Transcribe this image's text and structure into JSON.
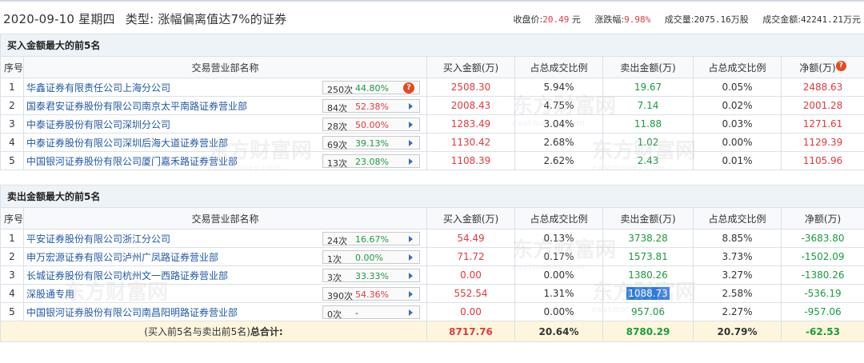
{
  "header": {
    "date": "2020-09-10",
    "weekday": "星期四",
    "type_label": "类型:",
    "type_value": "涨幅偏离值达7%的证券",
    "close_label": "收盘价:",
    "close_value": "20.49",
    "close_unit": "元",
    "change_label": "涨跌幅:",
    "change_value": "9.98%",
    "volume_label": "成交量:",
    "volume_value": "2075.16万股",
    "amount_label": "成交金额:",
    "amount_value": "42241.21万元"
  },
  "columns": {
    "idx": "序号",
    "name": "交易营业部名称",
    "buy": "买入金额(万)",
    "buy_ratio": "占总成交比例",
    "sell": "卖出金额(万)",
    "sell_ratio": "占总成交比例",
    "net": "净额(万)",
    "net_badge": "?"
  },
  "buy_section": {
    "title": "买入金额最大的前5名",
    "rows": [
      {
        "idx": "1",
        "name": "华鑫证券有限责任公司上海分公司",
        "count": "250次",
        "pct": "44.80%",
        "pct_color": "green",
        "badge": "?",
        "buy": "2508.30",
        "buy_ratio": "5.94%",
        "sell": "19.67",
        "sell_ratio": "0.05%",
        "net": "2488.63"
      },
      {
        "idx": "2",
        "name": "国泰君安证券股份有限公司南京太平南路证券营业部",
        "count": "84次",
        "pct": "52.38%",
        "pct_color": "red",
        "buy": "2008.43",
        "buy_ratio": "4.75%",
        "sell": "7.14",
        "sell_ratio": "0.02%",
        "net": "2001.28"
      },
      {
        "idx": "3",
        "name": "中泰证券股份有限公司深圳分公司",
        "count": "28次",
        "pct": "50.00%",
        "pct_color": "red",
        "buy": "1283.49",
        "buy_ratio": "3.04%",
        "sell": "11.88",
        "sell_ratio": "0.03%",
        "net": "1271.61"
      },
      {
        "idx": "4",
        "name": "中泰证券股份有限公司深圳后海大道证券营业部",
        "count": "69次",
        "pct": "39.13%",
        "pct_color": "green",
        "buy": "1130.42",
        "buy_ratio": "2.68%",
        "sell": "1.02",
        "sell_ratio": "0.00%",
        "net": "1129.39"
      },
      {
        "idx": "5",
        "name": "中国银河证券股份有限公司厦门嘉禾路证券营业部",
        "count": "13次",
        "pct": "23.08%",
        "pct_color": "green",
        "buy": "1108.39",
        "buy_ratio": "2.62%",
        "sell": "2.43",
        "sell_ratio": "0.01%",
        "net": "1105.96"
      }
    ]
  },
  "sell_section": {
    "title": "卖出金额最大的前5名",
    "rows": [
      {
        "idx": "1",
        "name": "平安证券股份有限公司浙江分公司",
        "count": "24次",
        "pct": "16.67%",
        "pct_color": "green",
        "buy": "54.49",
        "buy_ratio": "0.13%",
        "sell": "3738.28",
        "sell_ratio": "8.85%",
        "net": "-3683.80"
      },
      {
        "idx": "2",
        "name": "申万宏源证券有限公司泸州广凤路证券营业部",
        "count": "1次",
        "pct": "0.00%",
        "pct_color": "green",
        "buy": "71.72",
        "buy_ratio": "0.17%",
        "sell": "1573.81",
        "sell_ratio": "3.73%",
        "net": "-1502.09"
      },
      {
        "idx": "3",
        "name": "长城证券股份有限公司杭州文一西路证券营业部",
        "count": "3次",
        "pct": "33.33%",
        "pct_color": "green",
        "buy": "0.00",
        "buy_ratio": "0.00%",
        "sell": "1380.26",
        "sell_ratio": "3.27%",
        "net": "-1380.26"
      },
      {
        "idx": "4",
        "name": "深股通专用",
        "count": "390次",
        "pct": "54.36%",
        "pct_color": "red",
        "buy": "552.54",
        "buy_ratio": "1.31%",
        "sell": "1088.73",
        "sell_ratio": "2.58%",
        "net": "-536.19"
      },
      {
        "idx": "5",
        "name": "中国银河证券股份有限公司南昌阳明路证券营业部",
        "count": "0次",
        "pct": "-",
        "pct_color": "none",
        "buy": "0.00",
        "buy_ratio": "0.00%",
        "sell": "957.06",
        "sell_ratio": "2.27%",
        "net": "-957.06"
      }
    ]
  },
  "total": {
    "label_prefix": "(买入前5名与卖出前5名)",
    "label_suffix": "总合计:",
    "buy": "8717.76",
    "buy_ratio": "20.64%",
    "sell": "8780.29",
    "sell_ratio": "20.79%",
    "net": "-62.53"
  },
  "watermark": {
    "cn": "东方财富网",
    "en": "eastmoney.com"
  },
  "colors": {
    "red": "#e4393c",
    "green": "#1a9c3e",
    "link": "#2258a8",
    "header_bg": "#eef3f8",
    "total_bg": "#fdf6dd"
  }
}
